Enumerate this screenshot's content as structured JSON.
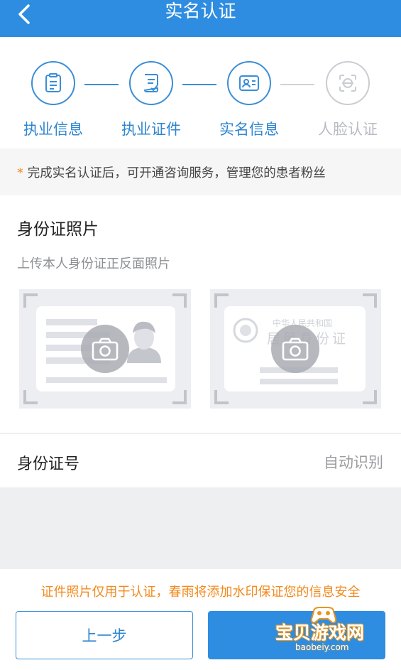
{
  "header": {
    "title": "实名认证",
    "back_icon": "chevron-left-icon"
  },
  "steps": [
    {
      "label": "执业信息",
      "icon": "clipboard-list-icon",
      "state": "done"
    },
    {
      "label": "执业证件",
      "icon": "document-check-icon",
      "state": "done"
    },
    {
      "label": "实名信息",
      "icon": "id-card-icon",
      "state": "current"
    },
    {
      "label": "人脸认证",
      "icon": "face-scan-icon",
      "state": "pending"
    }
  ],
  "notice": {
    "star": "*",
    "text": "完成实名认证后，可开通咨询服务，管理您的患者粉丝"
  },
  "id_photo": {
    "title": "身份证照片",
    "subtitle": "上传本人身份证正反面照片",
    "back_card_text": [
      "中华人民共和国",
      "居民身份证"
    ]
  },
  "id_number": {
    "label": "身份证号",
    "value": "自动识别"
  },
  "footer": {
    "note": "证件照片仅用于认证，春雨将添加水印保证您的信息安全",
    "prev_label": "上一步",
    "next_label": ""
  },
  "watermark": {
    "title": "宝贝游戏网",
    "url": "baobeiy.com"
  },
  "colors": {
    "primary": "#2e8de0",
    "accent_orange": "#f28a1e",
    "inactive": "#c9ccd1"
  }
}
